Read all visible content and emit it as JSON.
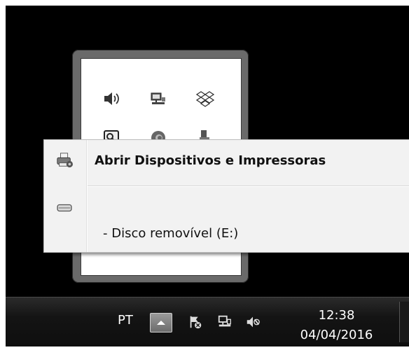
{
  "overflow_icons": [
    {
      "name": "volume-icon"
    },
    {
      "name": "network-icon"
    },
    {
      "name": "dropbox-icon"
    },
    {
      "name": "magnifier-tool-icon"
    },
    {
      "name": "app-c-icon"
    },
    {
      "name": "usb-device-icon"
    }
  ],
  "context_menu": {
    "items": [
      {
        "label": "Abrir Dispositivos e Impressoras",
        "icon": "printer-icon"
      },
      {
        "label": "",
        "icon": "removable-drive-icon"
      },
      {
        "label": "-  Disco removível (E:)",
        "icon": ""
      }
    ]
  },
  "taskbar": {
    "language": "PT",
    "clock": {
      "time": "12:38",
      "date": "04/04/2016"
    },
    "icons": [
      "show-hidden-icons-arrow",
      "action-center-flag-icon",
      "network-icon",
      "volume-icon"
    ]
  }
}
